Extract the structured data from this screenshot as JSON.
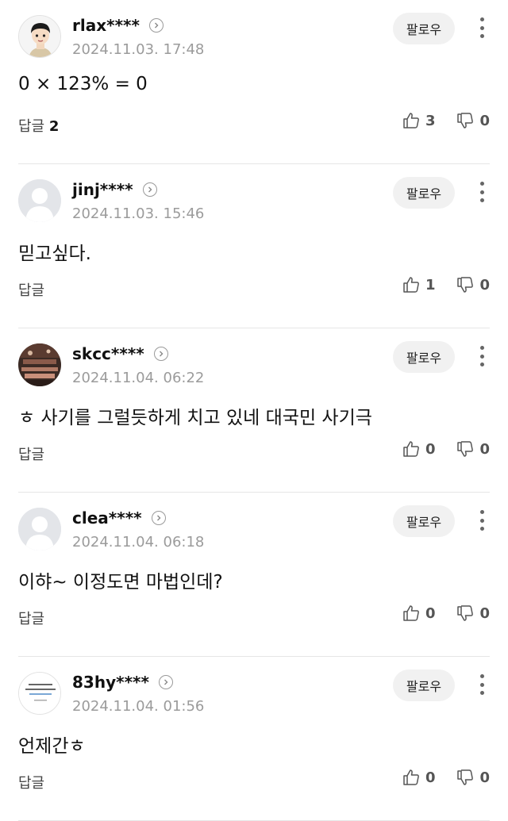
{
  "ui": {
    "follow_label": "팔로우",
    "reply_label": "답글"
  },
  "comments": [
    {
      "nick": "rlax****",
      "date": "2024.11.03. 17:48",
      "text": "0 × 123% = 0",
      "reply_count": "2",
      "likes": "3",
      "dislikes": "0",
      "avatar": "cartoon-man-avatar"
    },
    {
      "nick": "jinj****",
      "date": "2024.11.03. 15:46",
      "text": "믿고싶다.",
      "reply_count": "",
      "likes": "1",
      "dislikes": "0",
      "avatar": "default-avatar"
    },
    {
      "nick": "skcc****",
      "date": "2024.11.04. 06:22",
      "text": "ㅎ 사기를 그럴듯하게 치고 있네 대국민 사기극",
      "reply_count": "",
      "likes": "0",
      "dislikes": "0",
      "avatar": "photo-avatar"
    },
    {
      "nick": "clea****",
      "date": "2024.11.04. 06:18",
      "text": "이햐~ 이정도면 마법인데?",
      "reply_count": "",
      "likes": "0",
      "dislikes": "0",
      "avatar": "default-avatar"
    },
    {
      "nick": "83hy****",
      "date": "2024.11.04. 01:56",
      "text": "언제간ㅎ",
      "reply_count": "",
      "likes": "0",
      "dislikes": "0",
      "avatar": "quote-text-avatar"
    }
  ]
}
